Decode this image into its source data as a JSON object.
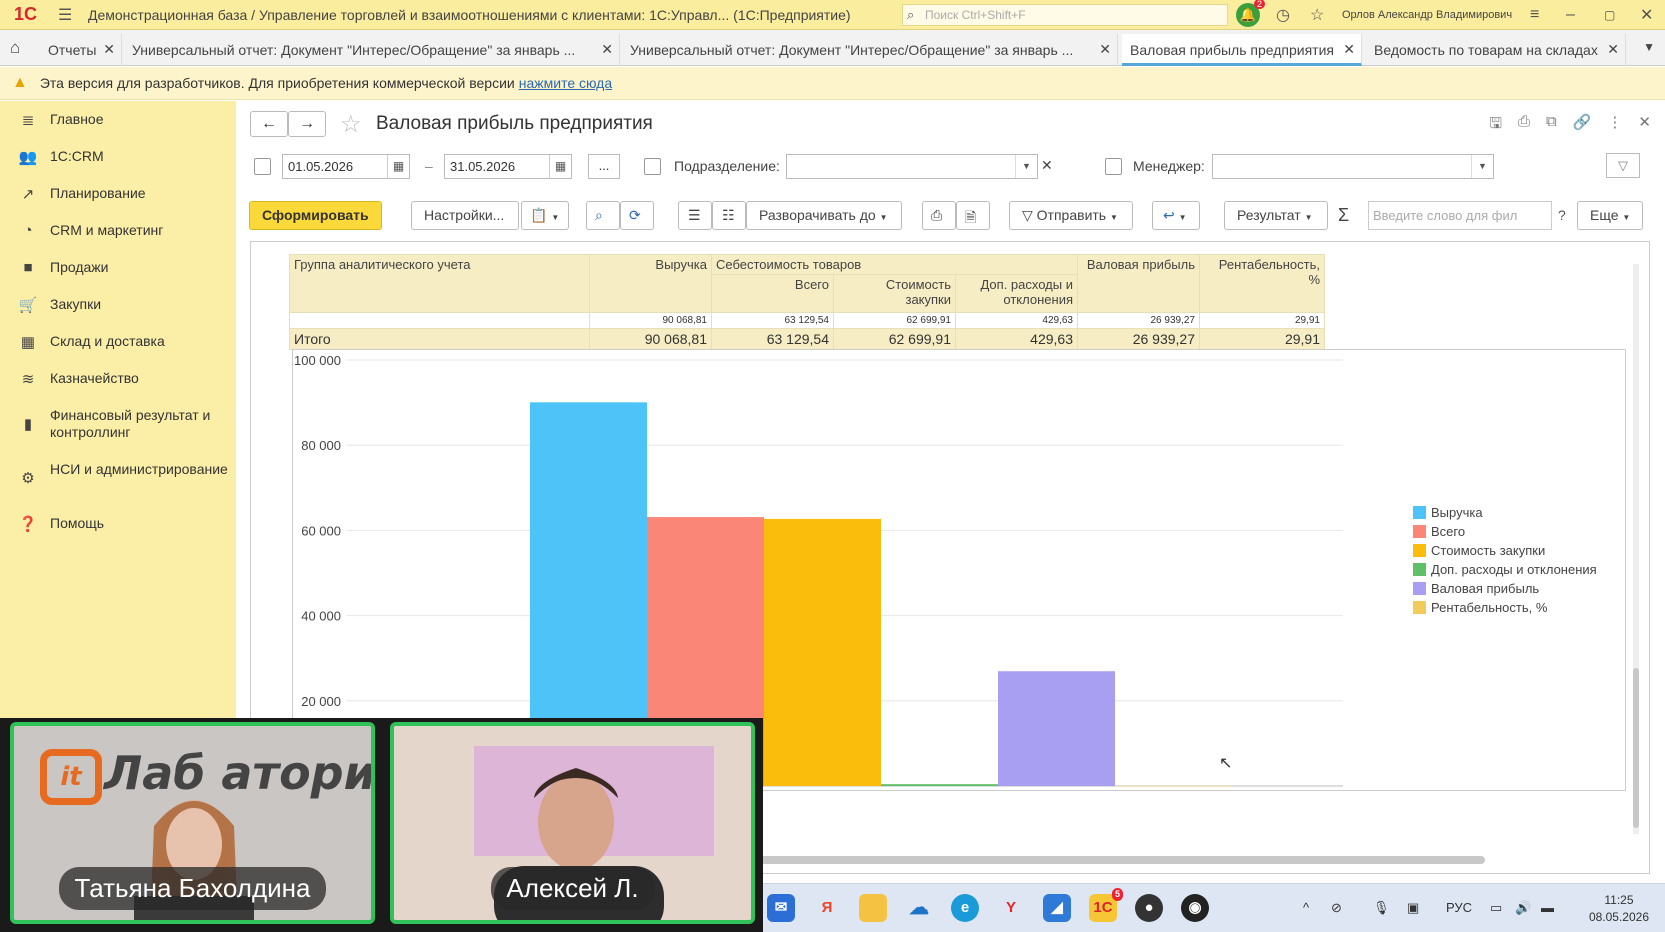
{
  "window": {
    "logo": "1С",
    "title": "Демонстрационная база / Управление торговлей и взаимоотношениями с клиентами: 1С:Управл...   (1С:Предприятие)",
    "search_placeholder": "Поиск Ctrl+Shift+F",
    "notification_count": "2",
    "user": "Орлов Александр Владимирович"
  },
  "tabs": [
    {
      "label": "Отчеты"
    },
    {
      "label": "Универсальный отчет: Документ \"Интерес/Обращение\" за январь ..."
    },
    {
      "label": "Универсальный отчет: Документ \"Интерес/Обращение\" за январь ..."
    },
    {
      "label": "Валовая прибыль предприятия"
    },
    {
      "label": "Ведомость по товарам на складах"
    }
  ],
  "devbar": {
    "text": "Эта версия для разработчиков. Для приобретения коммерческой версии",
    "link": "нажмите сюда"
  },
  "sidebar": {
    "items": [
      {
        "label": "Главное"
      },
      {
        "label": "1С:CRM"
      },
      {
        "label": "Планирование"
      },
      {
        "label": "CRM и маркетинг"
      },
      {
        "label": "Продажи"
      },
      {
        "label": "Закупки"
      },
      {
        "label": "Склад и доставка"
      },
      {
        "label": "Казначейство"
      },
      {
        "label": "Финансовый результат и контроллинг"
      },
      {
        "label": "НСИ и администрирование"
      },
      {
        "label": "Помощь"
      }
    ]
  },
  "report": {
    "title": "Валовая прибыль предприятия",
    "date_from": "01.05.2026",
    "date_sep": "–",
    "date_to": "31.05.2026",
    "ellipsis": "...",
    "subdivision_label": "Подразделение:",
    "manager_label": "Менеджер:",
    "buttons": {
      "generate": "Сформировать",
      "settings": "Настройки...",
      "expand": "Разворачивать до",
      "send": "Отправить",
      "result": "Результат",
      "more": "Еще"
    },
    "filter_placeholder": "Введите слово для фил",
    "help": "?",
    "table": {
      "h_group": "Группа аналитического учета",
      "h_revenue": "Выручка",
      "h_cost": "Себестоимость товаров",
      "h_total": "Всего",
      "h_purchase": "Стоимость закупки",
      "h_extra": "Доп. расходы и отклонения",
      "h_gross": "Валовая прибыль",
      "h_margin": "Рентабельность, %",
      "small_values": [
        "90 068,81",
        "63 129,54",
        "62 699,91",
        "429,63",
        "26 939,27",
        "29,91"
      ],
      "total_label": "Итого",
      "total_values": [
        "90 068,81",
        "63 129,54",
        "62 699,91",
        "429,63",
        "26 939,27",
        "29,91"
      ]
    }
  },
  "chart_data": {
    "type": "bar",
    "categories": [
      "Итого"
    ],
    "ylim": [
      0,
      100000
    ],
    "yticks": [
      "100 000",
      "80 000",
      "60 000",
      "40 000",
      "20 000"
    ],
    "series": [
      {
        "name": "Выручка",
        "value": 90068.81,
        "color": "#4ec3f7"
      },
      {
        "name": "Всего",
        "value": 63129.54,
        "color": "#f98677"
      },
      {
        "name": "Стоимость закупки",
        "value": 62699.91,
        "color": "#fbbd0b"
      },
      {
        "name": "Доп. расходы и отклонения",
        "value": 429.63,
        "color": "#60c06a"
      },
      {
        "name": "Валовая прибыль",
        "value": 26939.27,
        "color": "#a89ef2"
      },
      {
        "name": "Рентабельность, %",
        "value": 29.91,
        "color": "#f2cc5a"
      }
    ],
    "legend": "right",
    "grid": true
  },
  "video": {
    "brand": "Лаб  атория",
    "brand_badge": "it",
    "participant1": "Татьяна Бахолдина",
    "participant2": "Алексей Л."
  },
  "taskbar": {
    "lang": "РУС",
    "time": "11:25",
    "date": "08.05.2026",
    "badge_1c": "5"
  }
}
